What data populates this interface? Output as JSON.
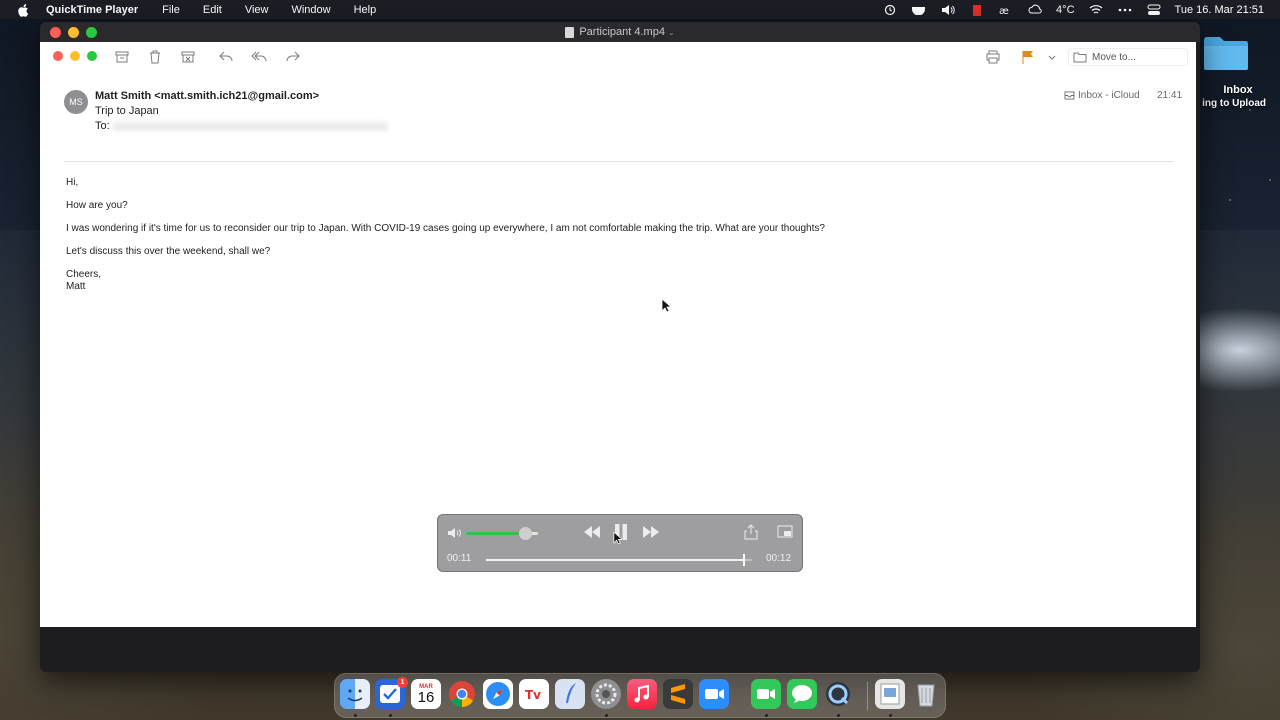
{
  "menubar": {
    "app_name": "QuickTime Player",
    "items": [
      "File",
      "Edit",
      "View",
      "Window",
      "Help"
    ],
    "temperature": "4°C",
    "clock": "Tue 16. Mar  21:51",
    "icons": [
      "apple-icon",
      "time-machine-icon",
      "coffee-icon",
      "volume-icon",
      "battery-icon",
      "ae-icon",
      "weather-icon",
      "wifi-icon",
      "more-icon",
      "control-center-icon"
    ]
  },
  "window": {
    "title": "Participant 4.mp4"
  },
  "mail": {
    "toolbar": {
      "icons": [
        "archive-icon",
        "trash-icon",
        "junk-icon",
        "reply-icon",
        "reply-all-icon",
        "forward-icon",
        "print-icon",
        "flag-icon",
        "chevron-down-icon",
        "folder-icon"
      ],
      "move_to_label": "Move to..."
    },
    "avatar_initials": "MS",
    "from": "Matt Smith <matt.smith.ich21@gmail.com>",
    "subject": "Trip to Japan",
    "to_label": "To:",
    "mailbox": "Inbox - iCloud",
    "time": "21:41",
    "body": {
      "greeting": "Hi,",
      "line1": "How are you?",
      "line2": "I was wondering if it's time for us to reconsider our trip to Japan. With COVID-19 cases going up everywhere, I am not comfortable making the trip. What are your thoughts?",
      "line3": "Let's discuss this over the weekend, shall we?",
      "signoff": "Cheers,",
      "signature": "Matt"
    }
  },
  "player": {
    "current_time": "00:11",
    "end_time": "00:12",
    "volume_fraction": 0.82,
    "progress_fraction": 0.97,
    "volume_color": "#33c24a"
  },
  "desktop": {
    "folder_label": "Inbox",
    "folder_sublabel": "ing to Upload"
  },
  "dock": {
    "calendar_month": "MAR",
    "calendar_day": "16",
    "reminders_badge": "1",
    "apps": [
      "finder",
      "reminders",
      "calendar",
      "chrome",
      "safari",
      "tv",
      "quill",
      "system-preferences",
      "music",
      "sublime",
      "zoom",
      "facetime",
      "messages",
      "quicktime",
      "preview",
      "trash"
    ]
  }
}
